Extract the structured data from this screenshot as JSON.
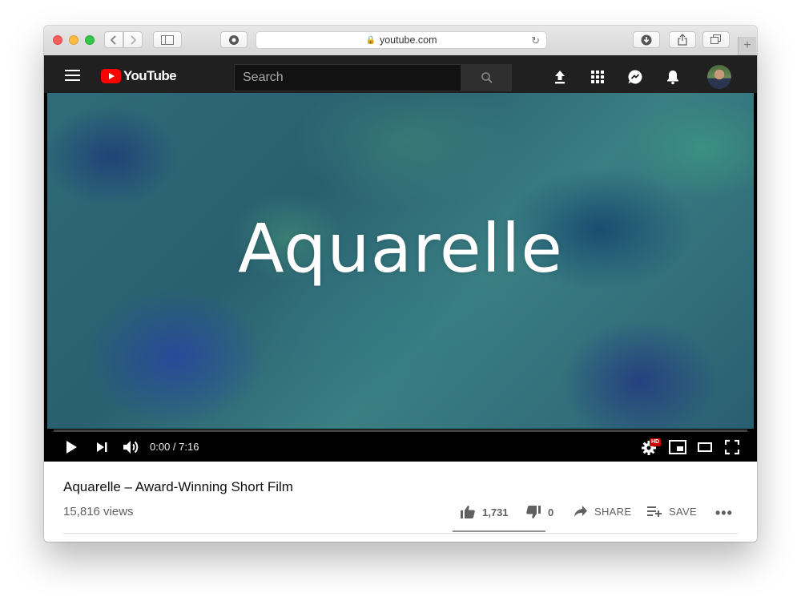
{
  "browser": {
    "url": "youtube.com"
  },
  "youtube": {
    "logo_text": "YouTube",
    "search_placeholder": "Search"
  },
  "player": {
    "overlay_title": "Aquarelle",
    "time": "0:00 / 7:16",
    "progress_fraction": 0.0,
    "hd_badge": "HD"
  },
  "video": {
    "title": "Aquarelle – Award-Winning Short Film",
    "views": "15,816 views",
    "likes": "1,731",
    "dislikes": "0",
    "share_label": "SHARE",
    "save_label": "SAVE"
  }
}
